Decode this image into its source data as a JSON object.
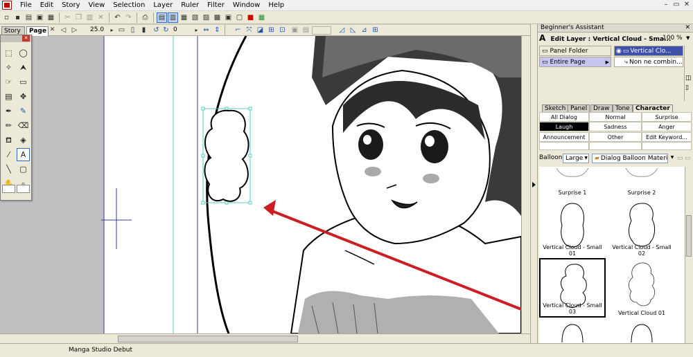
{
  "menu": [
    "File",
    "Edit",
    "Story",
    "View",
    "Selection",
    "Layer",
    "Ruler",
    "Filter",
    "Window",
    "Help"
  ],
  "window_controls": [
    "–",
    "▭",
    "✕"
  ],
  "doc_tabs": [
    "Story",
    "Page"
  ],
  "toolbar2": {
    "zoom_value": "25.0",
    "rotate_value": "0"
  },
  "assistant": {
    "title": "Beginner's Assistant",
    "edit_layer_label": "Edit Layer : Vertical Cloud - Sma...",
    "zoom_percent": "100 %",
    "left_list": [
      "Panel Folder",
      "Entire Page"
    ],
    "right_list": [
      "Vertical Clo...",
      "Non ne combin..."
    ]
  },
  "character_tabs": [
    "Sketch",
    "Panel",
    "Draw",
    "Tone",
    "Character"
  ],
  "categories": [
    [
      "All Dialog Balloons",
      "Normal",
      "Surprise"
    ],
    [
      "Laugh",
      "Sadness",
      "Anger"
    ],
    [
      "Announcement",
      "Other",
      "Edit Keyword..."
    ]
  ],
  "balloon_bar": {
    "label": "Balloon:",
    "size": "Large",
    "material": "Dialog Balloon Material"
  },
  "thumbnails": [
    "Surprise 1",
    "Surprise 2",
    "Vertical Cloud - Small 01",
    "Vertical Cloud - Small 02",
    "Vertical Cloud - Small 03",
    "Vertical Cloud 01"
  ],
  "status": "Manga Studio Debut",
  "colors": {
    "accent": "#316ac5",
    "arrow": "#cc1f25",
    "selection": "#59c9c6",
    "guide": "#3a3aa0"
  }
}
